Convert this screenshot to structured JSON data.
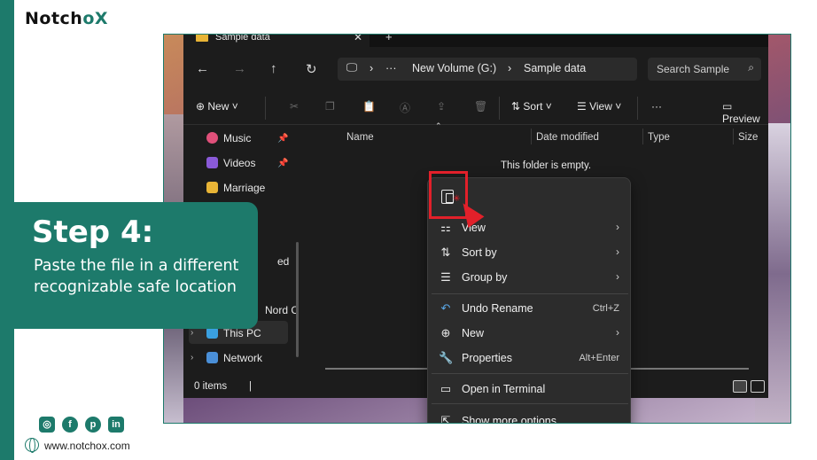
{
  "brand": {
    "logo_text": "Notch",
    "logo_accent": "oX",
    "website": "www.notchox.com",
    "accent_color": "#1d7a6b"
  },
  "step": {
    "title": "Step 4:",
    "description": "Paste the file in a different recognizable safe location"
  },
  "explorer": {
    "tab_title": "Sample data",
    "tab_close": "✕",
    "tab_new": "+",
    "breadcrumb": [
      "New Volume (G:)",
      "Sample data"
    ],
    "breadcrumb_more": "···",
    "search_placeholder": "Search Sample",
    "toolbar": {
      "new_label": "New",
      "sort_label": "Sort",
      "view_label": "View",
      "more_label": "···",
      "preview_label": "Preview"
    },
    "sidebar": {
      "items": [
        {
          "label": "Music",
          "icon": "music-icon"
        },
        {
          "label": "Videos",
          "icon": "videos-icon"
        },
        {
          "label": "Marriage",
          "icon": "folder-icon"
        },
        {
          "label": "ed",
          "icon": ""
        },
        {
          "label": "Nord C",
          "icon": ""
        },
        {
          "label": "This PC",
          "icon": "pc-icon"
        },
        {
          "label": "Network",
          "icon": "network-icon"
        }
      ]
    },
    "columns": [
      "Name",
      "Date modified",
      "Type",
      "Size"
    ],
    "empty_message": "This folder is empty.",
    "status": "0 items"
  },
  "context_menu": {
    "items": [
      {
        "label": "View",
        "icon": "view-icon",
        "has_submenu": true
      },
      {
        "label": "Sort by",
        "icon": "sort-icon",
        "has_submenu": true
      },
      {
        "label": "Group by",
        "icon": "group-icon",
        "has_submenu": true
      },
      {
        "label": "Undo Rename",
        "icon": "undo-icon",
        "shortcut": "Ctrl+Z"
      },
      {
        "label": "New",
        "icon": "new-icon",
        "has_submenu": true
      },
      {
        "label": "Properties",
        "icon": "properties-icon",
        "shortcut": "Alt+Enter"
      },
      {
        "label": "Open in Terminal",
        "icon": "terminal-icon"
      },
      {
        "label": "Show more options",
        "icon": "more-options-icon"
      }
    ]
  }
}
